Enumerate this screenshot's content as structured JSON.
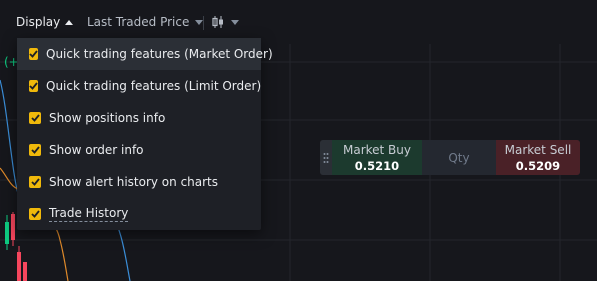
{
  "toolbar": {
    "display_label": "Display",
    "price_source_label": "Last Traded Price",
    "candle_icon": "candlestick-icon"
  },
  "display_menu": {
    "items": [
      {
        "label": "Quick trading features (Market Order)",
        "checked": true
      },
      {
        "label": "Quick trading features (Limit Order)",
        "checked": true
      },
      {
        "label": "Show positions info",
        "checked": true
      },
      {
        "label": "Show order info",
        "checked": true
      },
      {
        "label": "Show alert history on charts",
        "checked": true
      },
      {
        "label": "Trade History",
        "checked": true
      }
    ]
  },
  "quick_trade": {
    "buy_label": "Market Buy",
    "buy_price": "0.5210",
    "qty_placeholder": "Qty",
    "sell_label": "Market Sell",
    "sell_price": "0.5209"
  },
  "chart_overlay": {
    "partial_text": "(+"
  },
  "colors": {
    "accent": "#f0b90b",
    "buy": "#0ecb81",
    "sell": "#f6465d",
    "background": "#16171c"
  }
}
